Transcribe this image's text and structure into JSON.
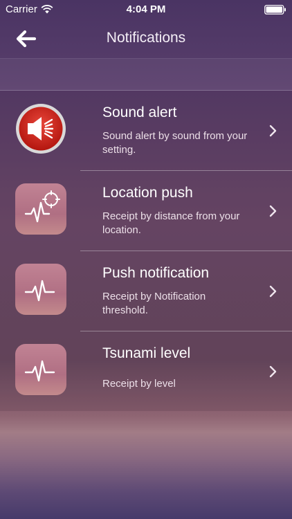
{
  "status_bar": {
    "carrier": "Carrier",
    "time": "4:04 PM",
    "wifi_icon": "wifi-icon",
    "battery_icon": "battery-icon"
  },
  "nav": {
    "title": "Notifications",
    "back_icon": "arrow-left-icon"
  },
  "items": [
    {
      "title": "Sound alert",
      "description": "Sound alert by sound from your setting.",
      "icon": "speaker-icon"
    },
    {
      "title": "Location push",
      "description": "Receipt by distance from your location.",
      "icon": "heartbeat-location-icon"
    },
    {
      "title": "Push notification",
      "description": "Receipt by Notification threshold.",
      "icon": "heartbeat-icon"
    },
    {
      "title": "Tsunami level",
      "description": "Receipt by level",
      "icon": "heartbeat-icon"
    }
  ],
  "colors": {
    "accent_red": "#d0251e",
    "icon_pink": "#c07f8f"
  }
}
